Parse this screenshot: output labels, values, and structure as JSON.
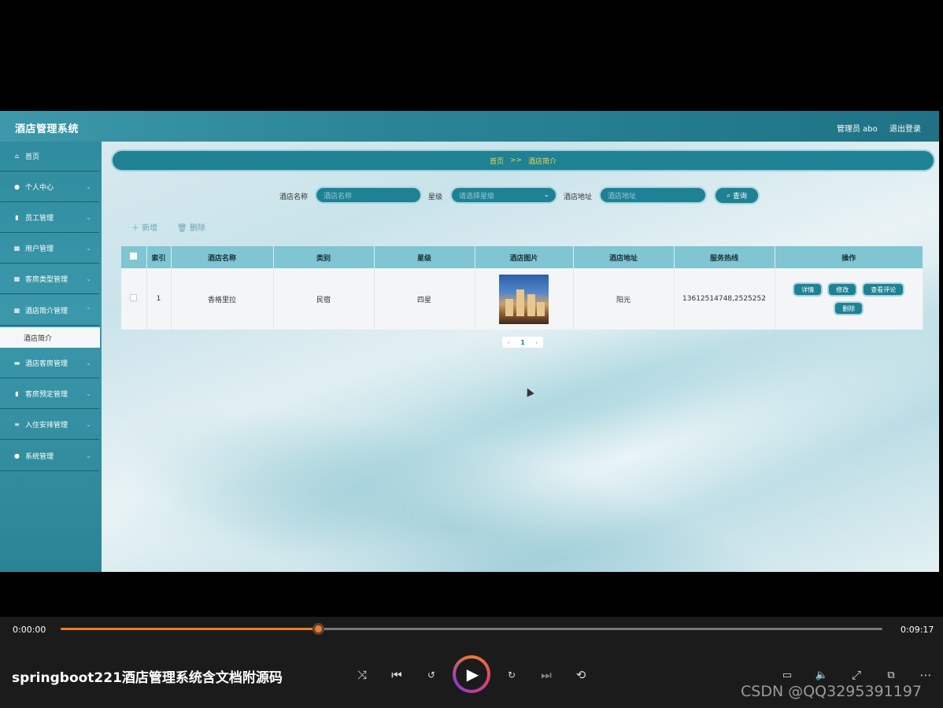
{
  "app": {
    "title": "酒店管理系统",
    "admin": "管理员 abo",
    "logout": "退出登录"
  },
  "sidebar": {
    "items": [
      {
        "label": "首页",
        "icon": "home-icon"
      },
      {
        "label": "个人中心",
        "icon": "user-icon"
      },
      {
        "label": "员工管理",
        "icon": "chart-icon"
      },
      {
        "label": "用户管理",
        "icon": "grid-icon"
      },
      {
        "label": "客房类型管理",
        "icon": "grid-icon"
      },
      {
        "label": "酒店简介管理",
        "icon": "grid-icon"
      },
      {
        "label": "酒店客房管理",
        "icon": "message-icon"
      },
      {
        "label": "客房预定管理",
        "icon": "bar-chart-icon"
      },
      {
        "label": "入住安排管理",
        "icon": "sliders-icon"
      },
      {
        "label": "系统管理",
        "icon": "user-icon"
      }
    ],
    "active_sub": "酒店简介"
  },
  "breadcrumb": {
    "home": "首页",
    "sep": ">>",
    "current": "酒店简介"
  },
  "search": {
    "name_label": "酒店名称",
    "name_placeholder": "酒店名称",
    "star_label": "星级",
    "star_placeholder": "请选择星级",
    "address_label": "酒店地址",
    "address_placeholder": "酒店地址",
    "query_button": "查询"
  },
  "toolbar": {
    "add": "新增",
    "delete": "删除"
  },
  "table": {
    "headers": [
      "索引",
      "酒店名称",
      "类别",
      "星级",
      "酒店图片",
      "酒店地址",
      "服务热线",
      "操作"
    ],
    "rows": [
      {
        "index": "1",
        "name": "香格里拉",
        "type": "民宿",
        "star": "四星",
        "address": "阳光",
        "hotline": "13612514748,2525252"
      }
    ],
    "actions": [
      "详情",
      "修改",
      "查看评论",
      "删除"
    ]
  },
  "pagination": {
    "prev": "‹",
    "page": "1",
    "next": "›"
  },
  "player": {
    "current_time": "0:00:00",
    "total_time": "0:09:17",
    "progress": 0.313,
    "title": "springboot221酒店管理系统含文档附源码",
    "watermark": "CSDN @QQ3295391197"
  }
}
